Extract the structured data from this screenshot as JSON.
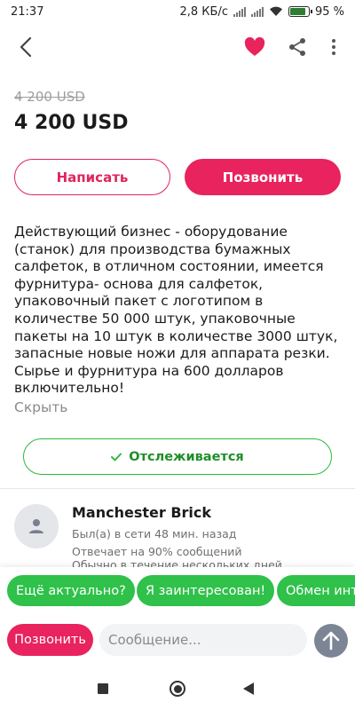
{
  "status": {
    "time": "21:37",
    "speed": "2,8 КБ/с",
    "battery": "95 %"
  },
  "listing": {
    "old_price": "4 200 USD",
    "price": "4 200 USD",
    "write_label": "Написать",
    "call_label": "Позвонить",
    "description": "Действующий бизнес - оборудование (станок) для производства бумажных салфеток, в отличном состоянии, имеется фурнитура- основа для салфеток, упаковочный пакет с логотипом в количестве 50 000 штук, упаковочные пакеты на 10 штук в количестве 3000 штук, запасные новые ножи для аппарата резки. Сырье и фурнитура на 600 долларов включительно!",
    "hide_label": "Скрыть",
    "tracking_label": "Отслеживается"
  },
  "seller": {
    "name": "Manchester Brick",
    "online": "Был(а) в сети 48 мин. назад",
    "reply_rate": "Отвечает на 90% сообщений",
    "reply_time": "Обычно в течение нескольких дней"
  },
  "quick_replies": [
    "Ещё актуально?",
    "Я заинтересован!",
    "Обмен интересует?"
  ],
  "message_bar": {
    "call_label": "Позвонить",
    "placeholder": "Сообщение..."
  },
  "icons": {
    "back": "chevron-left-icon",
    "favorite": "heart-icon",
    "share": "share-icon",
    "more": "more-vertical-icon",
    "tracking": "check-icon",
    "avatar": "user-icon",
    "send": "arrow-up-icon"
  },
  "colors": {
    "accent": "#e8235d",
    "green": "#2fc14a",
    "send_button": "#7c8595"
  }
}
